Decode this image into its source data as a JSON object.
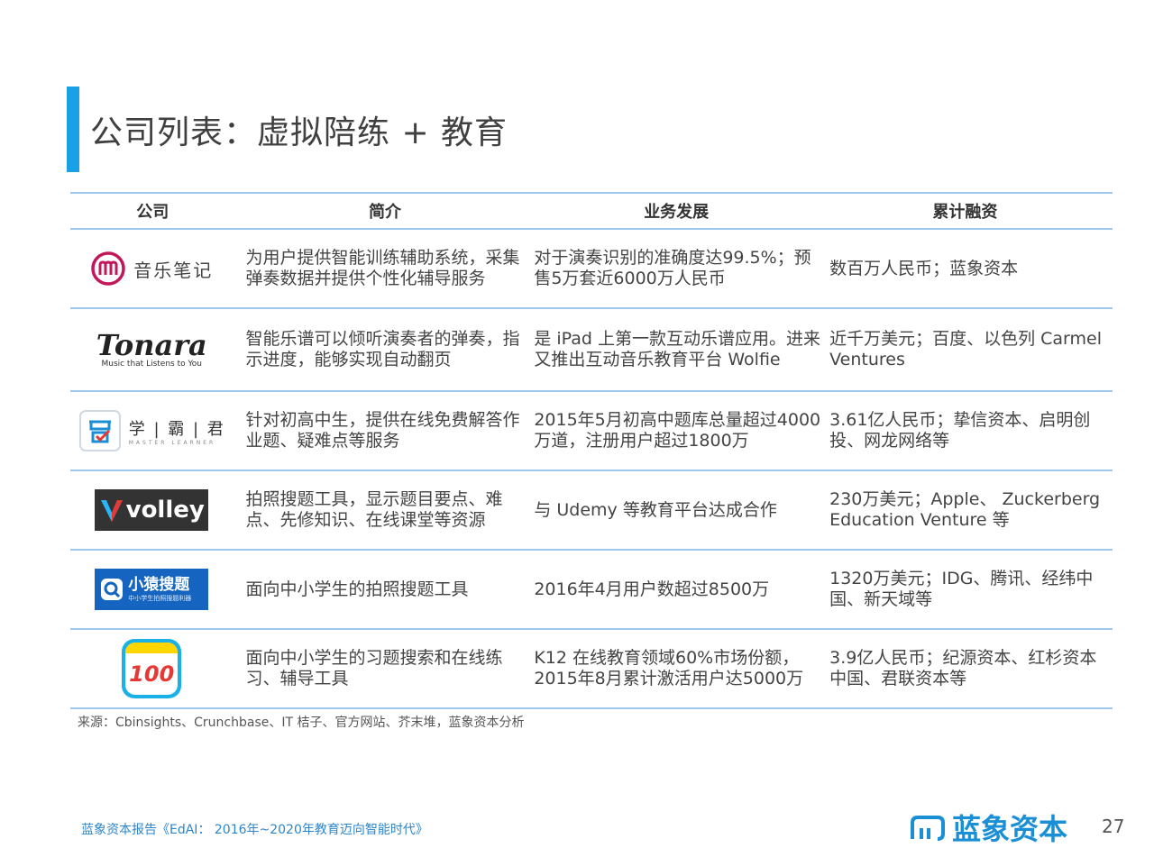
{
  "title": "公司列表：虚拟陪练 + 教育",
  "headers": {
    "company": "公司",
    "intro": "简介",
    "business": "业务发展",
    "funding": "累计融资"
  },
  "rows": [
    {
      "logo_text": "音乐笔记",
      "intro": "为用户提供智能训练辅助系统，采集弹奏数据并提供个性化辅导服务",
      "business": "对于演奏识别的准确度达99.5%；预售5万套近6000万人民币",
      "funding": "数百万人民币；蓝象资本"
    },
    {
      "logo_text": "Tonara",
      "logo_sub": "Music that Listens to You",
      "intro": "智能乐谱可以倾听演奏者的弹奏，指示进度，能够实现自动翻页",
      "business": "是 iPad 上第一款互动乐谱应用。进来又推出互动音乐教育平台 Wolfie",
      "funding": "近千万美元；百度、以色列 Carmel Ventures"
    },
    {
      "logo_text": "学 | 霸 | 君",
      "logo_sub": "MASTER LEARNER",
      "intro": "针对初高中生，提供在线免费解答作业题、疑难点等服务",
      "business": "2015年5月初高中题库总量超过4000万道，注册用户超过1800万",
      "funding": "3.61亿人民币；挚信资本、启明创投、网龙网络等"
    },
    {
      "logo_text": "volley",
      "intro": "拍照搜题工具，显示题目要点、难点、先修知识、在线课堂等资源",
      "business": "与 Udemy 等教育平台达成合作",
      "funding": "230万美元；Apple、 Zuckerberg Education Venture 等"
    },
    {
      "logo_text": "小猿搜题",
      "logo_sub": "中小学生拍照搜题利器",
      "intro": "面向中小学生的拍照搜题工具",
      "business": "2016年4月用户数超过8500万",
      "funding": "1320万美元；IDG、腾讯、经纬中国、新天域等"
    },
    {
      "logo_text": "100",
      "intro": "面向中小学生的习题搜索和在线练习、辅导工具",
      "business": "K12 在线教育领域60%市场份额，2015年8月累计激活用户达5000万",
      "funding": "3.9亿人民币；纪源资本、红杉资本中国、君联资本等"
    }
  ],
  "source": "来源：Cbinsights、Crunchbase、IT 桔子、官方网站、芥末堆，蓝象资本分析",
  "footer_left": "蓝象资本报告《EdAI： 2016年~2020年教育迈向智能时代》",
  "brand": "蓝象资本",
  "page_number": "27",
  "colors": {
    "accent": "#1aa0e6",
    "rule": "#9fc9e8",
    "footer_blue": "#2e86c9"
  }
}
